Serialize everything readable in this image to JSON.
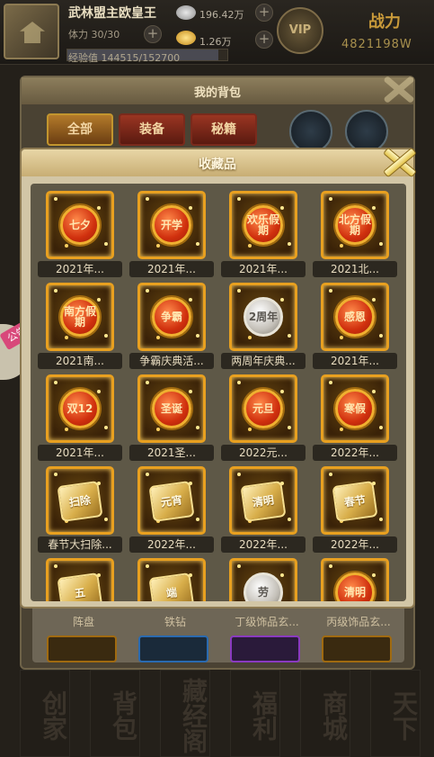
{
  "player": {
    "name": "武林盟主欧皇王",
    "stamina": "体力 30/30",
    "exp": "经验值 144515/152700",
    "exp_ratio": 0.946,
    "silver": "196.42万",
    "gold": "1.26万",
    "vip_label": "VIP",
    "power_label": "战力",
    "power_value": "4821198W"
  },
  "side_notice": {
    "label": "公告"
  },
  "bag": {
    "title": "我的背包",
    "tabs": [
      {
        "label": "全部",
        "active": true
      },
      {
        "label": "装备",
        "active": false
      },
      {
        "label": "秘籍",
        "active": false
      }
    ],
    "peek_labels": [
      "阵盘",
      "铁钻",
      "丁级饰品玄...",
      "丙级饰品玄..."
    ]
  },
  "bottom_nav": [
    "创家",
    "背包",
    "藏经阁",
    "福利",
    "商城",
    "天下"
  ],
  "collection": {
    "title": "收藏品",
    "items": [
      {
        "label": "2021年...",
        "coin_text": "七夕",
        "style": "red"
      },
      {
        "label": "2021年...",
        "coin_text": "开学",
        "style": "red"
      },
      {
        "label": "2021年...",
        "coin_text": "欢乐假期",
        "style": "red"
      },
      {
        "label": "2021北...",
        "coin_text": "北方假期",
        "style": "red"
      },
      {
        "label": "2021南...",
        "coin_text": "南方假期",
        "style": "red"
      },
      {
        "label": "争霸庆典活...",
        "coin_text": "争霸",
        "style": "red"
      },
      {
        "label": "两周年庆典...",
        "coin_text": "2周年",
        "style": "silver"
      },
      {
        "label": "2021年...",
        "coin_text": "感恩",
        "style": "red"
      },
      {
        "label": "2021年...",
        "coin_text": "双12",
        "style": "red"
      },
      {
        "label": "2021圣...",
        "coin_text": "圣诞",
        "style": "red"
      },
      {
        "label": "2022元...",
        "coin_text": "元旦",
        "style": "red"
      },
      {
        "label": "2022年...",
        "coin_text": "寒假",
        "style": "red"
      },
      {
        "label": "春节大扫除...",
        "coin_text": "扫除",
        "style": "plaque"
      },
      {
        "label": "2022年...",
        "coin_text": "元宵",
        "style": "plaque"
      },
      {
        "label": "2022年...",
        "coin_text": "清明",
        "style": "plaque"
      },
      {
        "label": "2022年...",
        "coin_text": "春节",
        "style": "plaque"
      },
      {
        "label": "",
        "coin_text": "五",
        "style": "plaque"
      },
      {
        "label": "",
        "coin_text": "端",
        "style": "plaque"
      },
      {
        "label": "",
        "coin_text": "劳",
        "style": "silver"
      },
      {
        "label": "",
        "coin_text": "清明",
        "style": "red"
      }
    ]
  },
  "colors": {
    "tile_border": "#e8a020",
    "popup_bg": "#d2c6a6",
    "grid_bg": "#5e5847",
    "power": "#c99a3a"
  }
}
